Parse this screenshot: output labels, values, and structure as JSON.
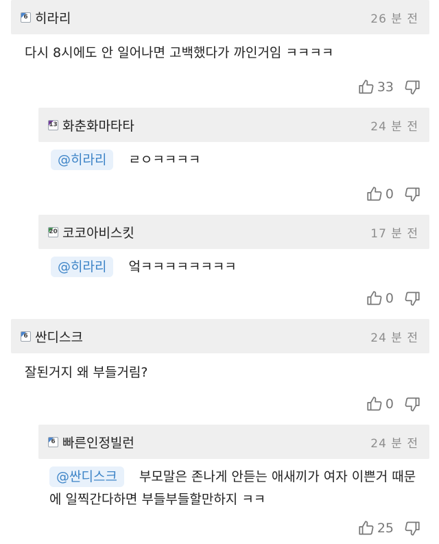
{
  "comments": [
    {
      "badge": "6",
      "badge_color": "#4a86d0",
      "nick": "히라리",
      "time": "26 분 전",
      "mention": "",
      "text": "다시 8시에도 안 일어나면 고백했다가 까인거임 ㅋㅋㅋㅋ",
      "likes": "33"
    },
    {
      "badge": "13",
      "badge_color": "#7a3ea8",
      "nick": "화춘화마타타",
      "time": "24 분 전",
      "mention": "@히라리",
      "text": "ㄹㅇㅋㅋㅋㅋ",
      "likes": "0"
    },
    {
      "badge": "20",
      "badge_color": "#4aa35a",
      "nick": "코코아비스킷",
      "time": "17 분 전",
      "mention": "@히라리",
      "text": "엌ㅋㅋㅋㅋㅋㅋㅋㅋ",
      "likes": "0"
    },
    {
      "badge": "6",
      "badge_color": "#4a86d0",
      "nick": "싼디스크",
      "time": "24 분 전",
      "mention": "",
      "text": "잘된거지 왜 부들거림?",
      "likes": "0"
    },
    {
      "badge": "6",
      "badge_color": "#4a86d0",
      "nick": "빠른인정빌런",
      "time": "24 분 전",
      "mention": "@싼디스크",
      "text": "부모말은 존나게 안듣는 애새끼가 여자 이쁜거 때문에 일찍간다하면 부들부들할만하지 ㅋㅋ",
      "likes": "25"
    }
  ],
  "icons": {
    "like": "thumbs-up-icon",
    "dislike": "thumbs-down-icon"
  }
}
